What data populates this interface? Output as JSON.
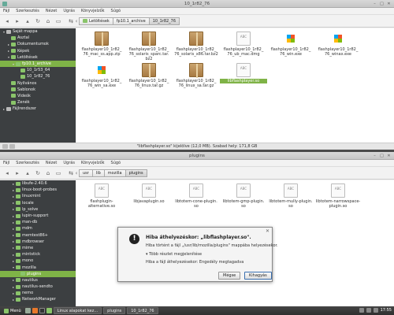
{
  "window1": {
    "title": "10_1r82_76",
    "menu": [
      "Fájl",
      "Szerkesztés",
      "Nézet",
      "Ugrás",
      "Könyvjelzők",
      "Súgó"
    ],
    "breadcrumbs": [
      "Letöltések",
      "fp10.1_archive",
      "10_1r82_76"
    ],
    "sidebar": [
      {
        "label": "Saját mappa",
        "indent": 0,
        "arrow": "▾"
      },
      {
        "label": "Asztal",
        "indent": 1,
        "arrow": ""
      },
      {
        "label": "Dokumentumok",
        "indent": 1,
        "arrow": "▸"
      },
      {
        "label": "Képek",
        "indent": 1,
        "arrow": "▸"
      },
      {
        "label": "Letöltések",
        "indent": 1,
        "arrow": "▾"
      },
      {
        "label": "fp10.1_archive",
        "indent": 2,
        "arrow": "▾"
      },
      {
        "label": "10_1r53_64",
        "indent": 3,
        "arrow": ""
      },
      {
        "label": "10_1r82_76",
        "indent": 3,
        "arrow": ""
      },
      {
        "label": "Nyilvános",
        "indent": 1,
        "arrow": ""
      },
      {
        "label": "Sablonok",
        "indent": 1,
        "arrow": ""
      },
      {
        "label": "Videók",
        "indent": 1,
        "arrow": ""
      },
      {
        "label": "Zenék",
        "indent": 1,
        "arrow": ""
      },
      {
        "label": "Fájlrendszer",
        "indent": 0,
        "arrow": "▸"
      }
    ],
    "files": [
      {
        "name": "flashplayer10_1r82_76_mac_ss.app.zip",
        "line1": "flashplayer10_1r82_",
        "line2": "76_mac_ss.app.zip",
        "kind": "pkg"
      },
      {
        "name": "flashplayer10_1r82_76_solaris_sparc.tar.bz2",
        "line1": "flashplayer10_1r82_",
        "line2": "76_solaris_sparc.tar.",
        "line3": "bz2",
        "kind": "pkg"
      },
      {
        "name": "flashplayer10_1r82_76_solaris_x86.tar.bz2",
        "line1": "flashplayer10_1r82_",
        "line2": "76_solaris_x86.tar.bz2",
        "kind": "pkg"
      },
      {
        "name": "flashplayer10_1r82_76_ub_mac.dmg",
        "line1": "flashplayer10_1r82_",
        "line2": "76_ub_mac.dmg",
        "kind": "doc"
      },
      {
        "name": "flashplayer10_1r82_76_win.exe",
        "line1": "flashplayer10_1r82_",
        "line2": "76_win.exe",
        "kind": "exe"
      },
      {
        "name": "flashplayer10_1r82_76_winax.exe",
        "line1": "flashplayer10_1r82_",
        "line2": "76_winax.exe",
        "kind": "exe"
      },
      {
        "name": "flashplayer10_1r82_76_win_sa.exe",
        "line1": "flashplayer10_1r82_",
        "line2": "76_win_sa.exe",
        "kind": "exe"
      },
      {
        "name": "flashplayer10_1r82_76_linux.tar.gz",
        "line1": "flashplayer10_1r82_",
        "line2": "76_linux.tar.gz",
        "kind": "pkg"
      },
      {
        "name": "flashplayer10_1r82_76_linux_sa.tar.gz",
        "line1": "flashplayer10_1r82_",
        "line2": "76_linux_sa.tar.gz",
        "kind": "pkg"
      },
      {
        "name": "libflashplayer.so",
        "line1": "libflashplayer.so",
        "line2": "",
        "kind": "doc",
        "selected": true
      }
    ],
    "status": "\"libflashplayer.so\" kijelölve (12,0 MB). Szabad hely: 171,8 GB"
  },
  "window2": {
    "title": "plugins",
    "menu": [
      "Fájl",
      "Szerkesztés",
      "Nézet",
      "Ugrás",
      "Könyvjelzők",
      "Súgó"
    ],
    "breadcrumbs": [
      "usr",
      "lib",
      "mozilla",
      "plugins"
    ],
    "sidebar": [
      {
        "label": "libufe-2.40.6",
        "indent": 2,
        "arrow": "▸"
      },
      {
        "label": "linux-boot-probes",
        "indent": 2,
        "arrow": "▸"
      },
      {
        "label": "linuxmint",
        "indent": 2,
        "arrow": "▸"
      },
      {
        "label": "locale",
        "indent": 2,
        "arrow": "▸"
      },
      {
        "label": "lp_solve",
        "indent": 2,
        "arrow": "▸"
      },
      {
        "label": "lupin-support",
        "indent": 2,
        "arrow": "▸"
      },
      {
        "label": "man-db",
        "indent": 2,
        "arrow": "▸"
      },
      {
        "label": "mdm",
        "indent": 2,
        "arrow": "▸"
      },
      {
        "label": "memtest86+",
        "indent": 2,
        "arrow": "▸"
      },
      {
        "label": "mdbrowser",
        "indent": 2,
        "arrow": "▸"
      },
      {
        "label": "mime",
        "indent": 2,
        "arrow": "▸"
      },
      {
        "label": "mintstick",
        "indent": 2,
        "arrow": "▸"
      },
      {
        "label": "mono",
        "indent": 2,
        "arrow": "▸"
      },
      {
        "label": "mozilla",
        "indent": 2,
        "arrow": "▾"
      },
      {
        "label": "plugins",
        "indent": 3,
        "arrow": "",
        "selected": true
      },
      {
        "label": "nautilus",
        "indent": 2,
        "arrow": "▸"
      },
      {
        "label": "nautilus-sendto",
        "indent": 2,
        "arrow": "▸"
      },
      {
        "label": "nemo",
        "indent": 2,
        "arrow": "▸"
      },
      {
        "label": "NetworkManager",
        "indent": 2,
        "arrow": "▸"
      }
    ],
    "files": [
      {
        "name": "flashplugin-alternative.so",
        "line1": "flashplugin-",
        "line2": "alternative.so"
      },
      {
        "name": "libjavaplugin.so",
        "line1": "libjavaplugin.so",
        "line2": ""
      },
      {
        "name": "libtotem-cone-plugin.so",
        "line1": "libtotem-cone-plugin.",
        "line2": "so"
      },
      {
        "name": "libtotem-gmp-plugin.so",
        "line1": "libtotem-gmp-plugin.",
        "line2": "so"
      },
      {
        "name": "libtotem-mully-plugin.so",
        "line1": "libtotem-mully-plugin.",
        "line2": "so"
      },
      {
        "name": "libtotem-narrowspace-plugin.so",
        "line1": "libtotem-narrowspace-",
        "line2": "plugin.so"
      }
    ]
  },
  "dialog": {
    "title": "Hiba áthelyezéskor: „libflashplayer.so\".",
    "message": "Hiba történt a fájl „/usr/lib/mozilla/plugins\" mappába helyezésekor.",
    "details_toggle": "Több részlet megjelenítése",
    "detail": "Hiba a fájl áthelyezésekor: Engedély megtagadva",
    "buttons": {
      "skip": "Mégse",
      "retry": "Kihagyás"
    }
  },
  "taskbar": {
    "menu_label": "Menü",
    "tasks": [
      "Linux alapokat kez...",
      "plugins",
      "10_1r82_76"
    ],
    "clock": "17:55"
  }
}
